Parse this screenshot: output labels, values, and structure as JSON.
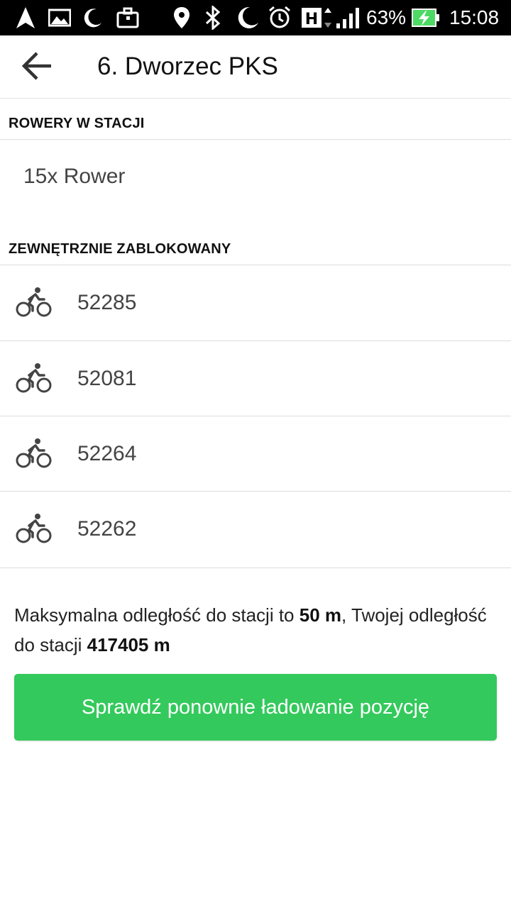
{
  "status_bar": {
    "battery_percent": "63%",
    "time": "15:08",
    "icons": [
      "navigation-icon",
      "image-icon",
      "moon-icon",
      "bag-icon",
      "location-icon",
      "bluetooth-icon",
      "do-not-disturb-icon",
      "alarm-icon",
      "network-h-icon",
      "signal-icon",
      "battery-charging-icon"
    ]
  },
  "header": {
    "title": "6. Dworzec PKS",
    "back_icon": "arrow-back-icon"
  },
  "sections": {
    "bikes_in_station": {
      "label": "ROWERY W STACJI",
      "summary": "15x Rower"
    },
    "externally_locked": {
      "label": "ZEWNĘTRZNIE ZABLOKOWANY",
      "bikes": [
        "52285",
        "52081",
        "52264",
        "52262"
      ],
      "icon": "bike-icon"
    }
  },
  "distance": {
    "prefix": "Maksymalna odległość do stacji to ",
    "max_distance": "50 m",
    "middle": ", Twojej odległość do stacji ",
    "your_distance": "417405 m"
  },
  "action": {
    "label": "Sprawdź ponownie ładowanie pozycję"
  },
  "colors": {
    "accent": "#34c95c",
    "status_bar_bg": "#000000",
    "battery_charging": "#4cd964"
  }
}
